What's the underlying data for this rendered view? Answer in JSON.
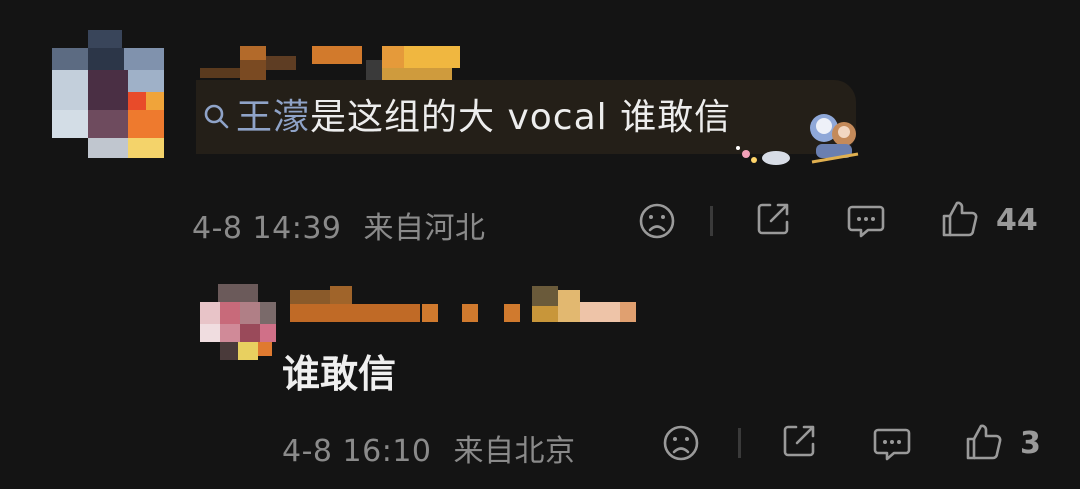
{
  "comment": {
    "mention": "王濛",
    "text": "是这组的大 vocal 谁敢信",
    "date": "4-8 14:39",
    "location": "来自河北",
    "likes": "44"
  },
  "reply": {
    "text": "谁敢信",
    "date": "4-8 16:10",
    "location": "来自北京",
    "likes": "3"
  },
  "icons": [
    "search-icon",
    "unhappy-face-icon",
    "share-icon",
    "comment-icon",
    "thumbs-up-icon"
  ],
  "colors": {
    "background": "#141414",
    "bubble": "#241f18",
    "mention": "#8fa3c8",
    "meta": "#8a8a8a"
  }
}
